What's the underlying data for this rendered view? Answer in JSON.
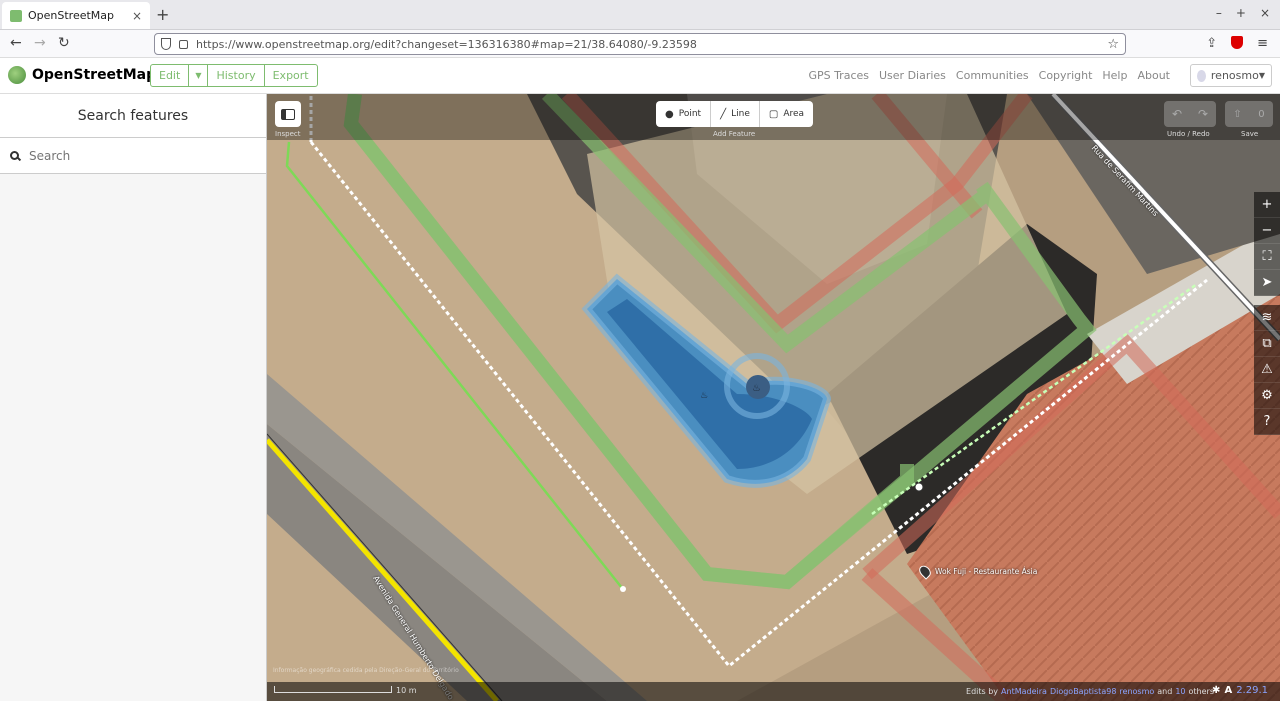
{
  "browser": {
    "tab_title": "OpenStreetMap",
    "tab_close": "×",
    "new_tab": "+",
    "url": "https://www.openstreetmap.org/edit?changeset=136316380#map=21/38.64080/-9.23598",
    "window_controls": [
      "–",
      "+",
      "×"
    ]
  },
  "osm": {
    "site_name": "OpenStreetMap",
    "edit_label": "Edit",
    "history_label": "History",
    "export_label": "Export",
    "links": [
      "GPS Traces",
      "User Diaries",
      "Communities",
      "Copyright",
      "Help",
      "About"
    ],
    "username": "renosmo"
  },
  "sidebar": {
    "title": "Search features",
    "search_placeholder": "Search"
  },
  "map": {
    "inspect_label": "Inspect",
    "tools": {
      "point": "Point",
      "line": "Line",
      "area": "Area",
      "caption": "Add Feature"
    },
    "undo_redo_label": "Undo / Redo",
    "save_label": "Save",
    "save_count": "0",
    "poi_label": "Wok Fuji - Restaurante Ásia",
    "street_1": "Avenida General Humberto Delgado",
    "street_2": "Rua de Serafim Martins",
    "imagery_attribution": "Informação geográfica cedida pela Direção-Geral do Território",
    "scale_label": "10 m",
    "edits_by_prefix": "Edits by",
    "editors": [
      "AntMadeira",
      "DiogoBaptista98",
      "renosmo"
    ],
    "and_label": "and",
    "others_count": "10",
    "others_label": "others",
    "version": "2.29.1"
  }
}
